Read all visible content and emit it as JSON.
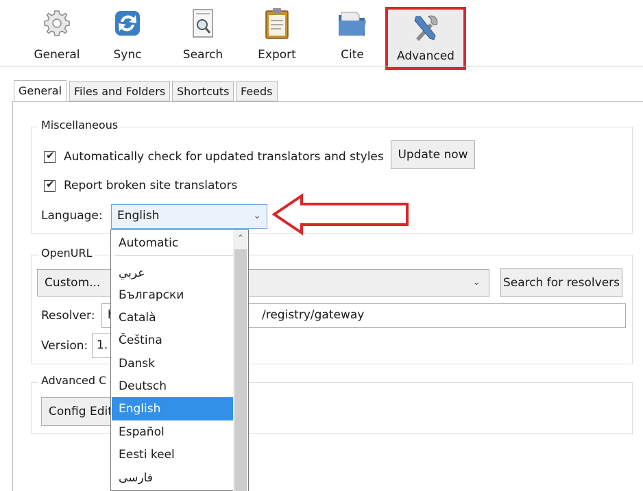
{
  "toolbar": {
    "items": [
      {
        "label": "General",
        "icon": "gear-icon"
      },
      {
        "label": "Sync",
        "icon": "sync-icon"
      },
      {
        "label": "Search",
        "icon": "search-icon"
      },
      {
        "label": "Export",
        "icon": "clipboard-icon"
      },
      {
        "label": "Cite",
        "icon": "folder-icon"
      },
      {
        "label": "Advanced",
        "icon": "tools-icon"
      }
    ],
    "active": "Advanced",
    "highlight_color": "#d9262b"
  },
  "tabs": [
    "General",
    "Files and Folders",
    "Shortcuts",
    "Feeds"
  ],
  "active_tab": "General",
  "miscellaneous": {
    "legend": "Miscellaneous",
    "auto_check_label": "Automatically check for updated translators and styles",
    "auto_check_checked": true,
    "update_now_label": "Update now",
    "report_broken_label": "Report broken site translators",
    "report_broken_checked": true,
    "language_label": "Language:",
    "language_value": "English"
  },
  "openurl": {
    "legend": "OpenURL",
    "custom_value": "Custom...",
    "search_resolvers_label": "Search for resolvers",
    "resolver_label": "Resolver:",
    "resolver_value_visible": "/registry/gateway",
    "resolver_prefix_visible": "h",
    "version_label": "Version:",
    "version_value_visible": "1."
  },
  "advanced_config": {
    "legend_visible": "Advanced C",
    "config_editor_visible": "Config Edit"
  },
  "language_dropdown": {
    "options": [
      "Automatic",
      "عربي",
      "Български",
      "Català",
      "Čeština",
      "Dansk",
      "Deutsch",
      "English",
      "Español",
      "Eesti keel",
      "فارسی"
    ],
    "selected": "English",
    "selected_color": "#3390e8"
  },
  "annotation": {
    "arrow_color": "#d9262b"
  }
}
